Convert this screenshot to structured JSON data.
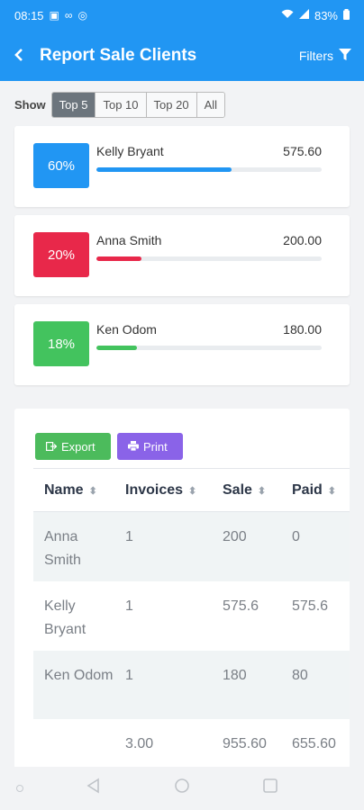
{
  "status_bar": {
    "time": "08:15",
    "battery": "83%"
  },
  "app_bar": {
    "title": "Report Sale Clients",
    "filters_label": "Filters"
  },
  "show": {
    "label": "Show",
    "options": [
      "Top 5",
      "Top 10",
      "Top 20",
      "All"
    ],
    "selected": "Top 5"
  },
  "cards": [
    {
      "percent": "60%",
      "name": "Kelly Bryant",
      "amount": "575.60",
      "progress": 0.6,
      "color": "#2196f3"
    },
    {
      "percent": "20%",
      "name": "Anna Smith",
      "amount": "200.00",
      "progress": 0.2,
      "color": "#e8284a"
    },
    {
      "percent": "18%",
      "name": "Ken Odom",
      "amount": "180.00",
      "progress": 0.18,
      "color": "#43c35e"
    }
  ],
  "table": {
    "export_label": "Export",
    "print_label": "Print",
    "headers": [
      "Name",
      "Invoices",
      "Sale",
      "Paid"
    ],
    "rows": [
      {
        "name": "Anna Smith",
        "invoices": "1",
        "sale": "200",
        "paid": "0"
      },
      {
        "name": "Kelly Bryant",
        "invoices": "1",
        "sale": "575.6",
        "paid": "575.6"
      },
      {
        "name": "Ken Odom",
        "invoices": "1",
        "sale": "180",
        "paid": "80"
      }
    ],
    "totals": {
      "name": "",
      "invoices": "3.00",
      "sale": "955.60",
      "paid": "655.60"
    }
  },
  "icons": {
    "back": "chevron-left-icon",
    "filter": "funnel-icon",
    "export": "export-icon",
    "print": "printer-icon",
    "sort": "sort-icon"
  }
}
